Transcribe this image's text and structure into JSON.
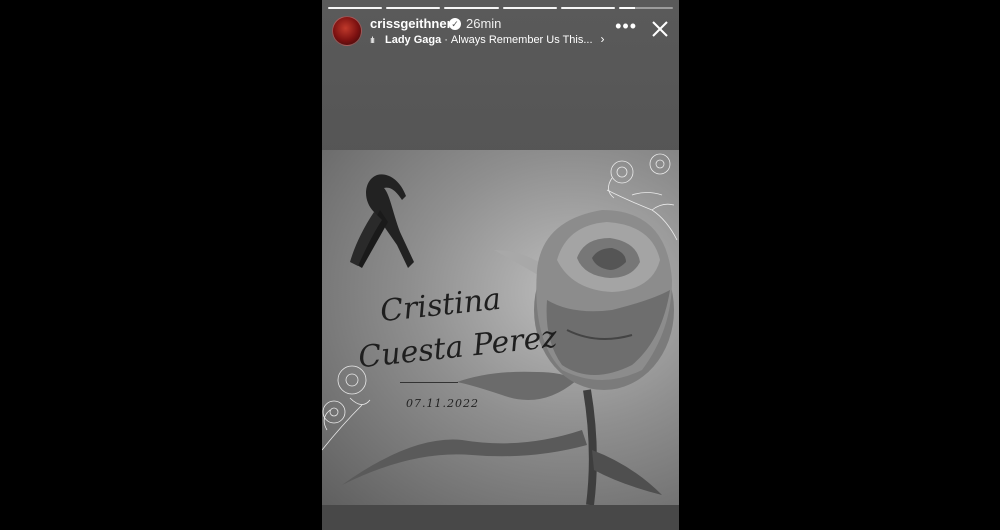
{
  "story": {
    "username": "crissgeithner",
    "time_ago": "26min",
    "music": {
      "artist": "Lady Gaga",
      "separator": "·",
      "track": "Always Remember Us This..."
    },
    "progress_segments": 6,
    "current_segment_fraction": 0.3
  },
  "photo": {
    "name_line1": "Cristina",
    "name_line2": "Cuesta Perez",
    "date": "07.11.2022"
  },
  "colors": {
    "background": "#000000",
    "story_bg": "#555555"
  },
  "icons": {
    "verified": "verified-badge-icon",
    "music": "audio-bars-icon",
    "more": "more-horizontal-icon",
    "close": "close-icon",
    "ribbon": "mourning-ribbon-icon"
  }
}
